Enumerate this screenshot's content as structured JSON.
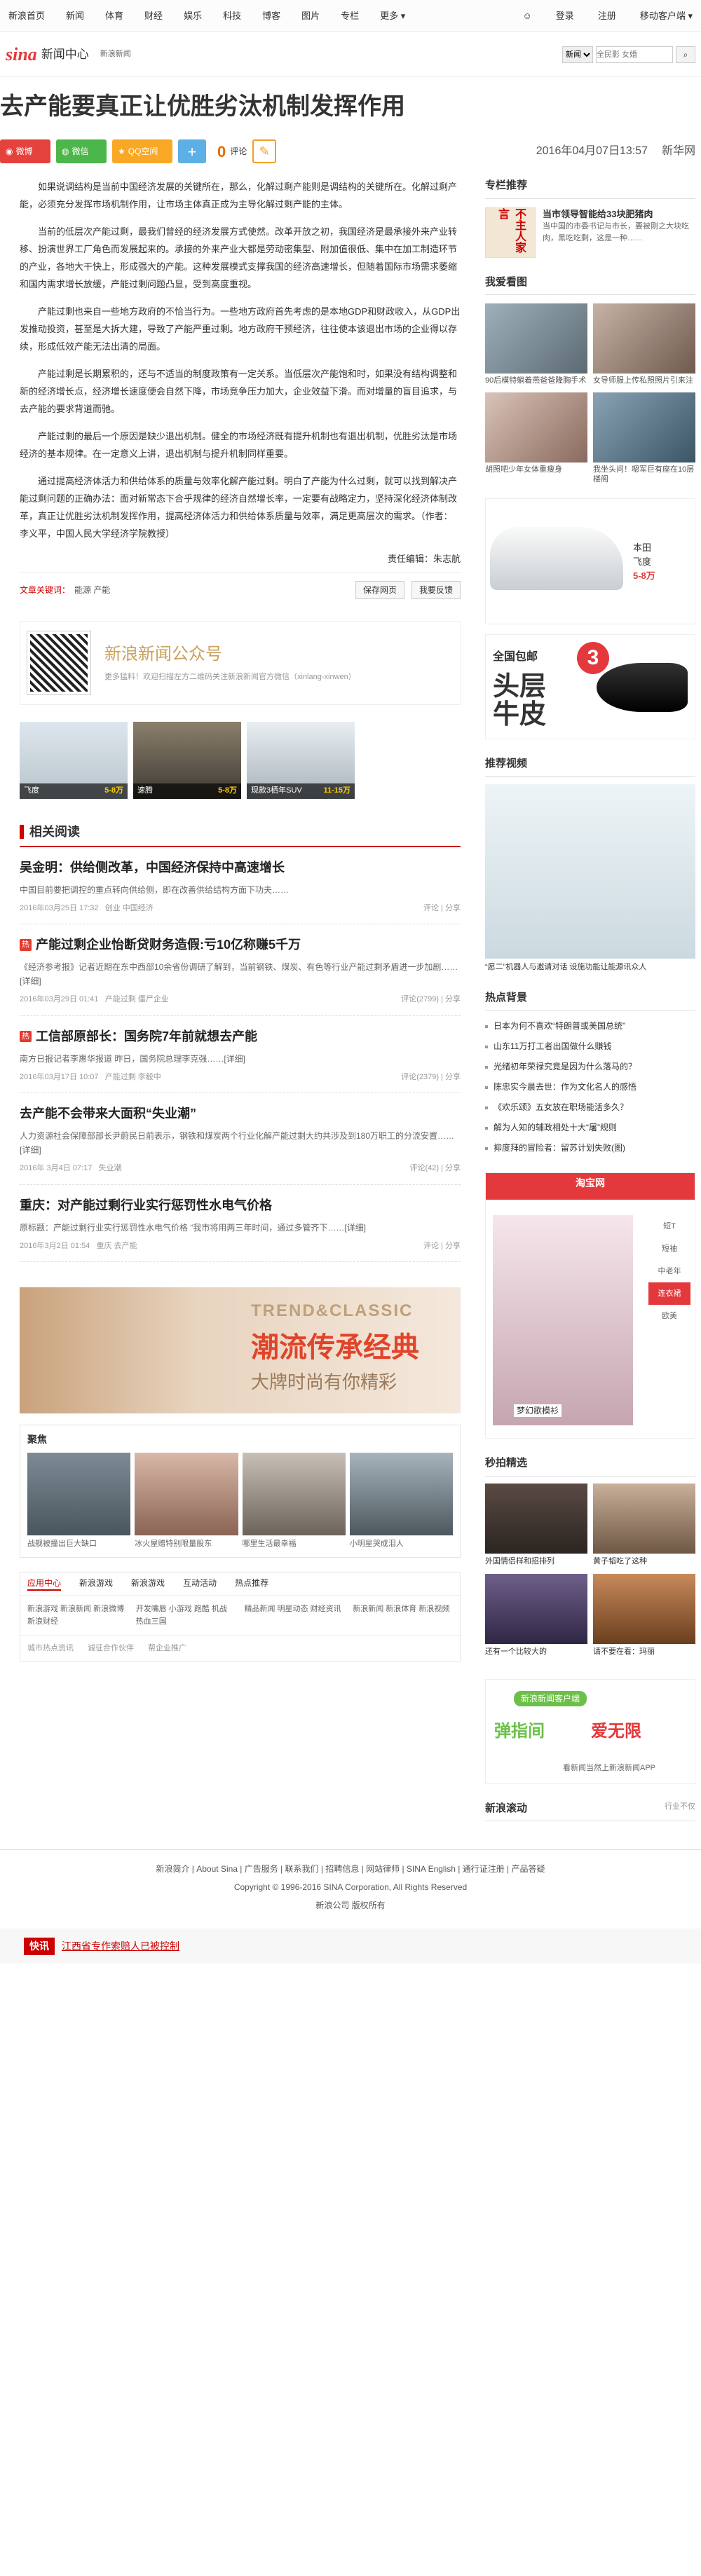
{
  "top_nav": {
    "items": [
      "新浪首页",
      "新闻",
      "体育",
      "财经",
      "娱乐",
      "科技",
      "博客",
      "图片",
      "专栏",
      "更多"
    ],
    "login": "登录",
    "register": "注册",
    "mobile": "移动客户端"
  },
  "header": {
    "logo_sina": "sina",
    "logo_text": "新闻中心",
    "logo_sub": "新浪新闻",
    "search_scope": "新闻",
    "search_placeholder": "全民影 女婚"
  },
  "article": {
    "title": "去产能要真正让优胜劣汰机制发挥作用",
    "share_weibo": "微博",
    "share_weixin": "微信",
    "share_qq": "QQ空间",
    "share_plus": "+",
    "comment_count": "0",
    "comment_label": "评论",
    "date": "2016年04月07日13:57",
    "source": "新华网",
    "paragraphs": [
      "如果说调结构是当前中国经济发展的关键所在，那么，化解过剩产能则是调结构的关键所在。化解过剩产能，必须充分发挥市场机制作用，让市场主体真正成为主导化解过剩产能的主体。",
      "当前的低层次产能过剩，最我们曾经的经济发展方式使然。改革开放之初，我国经济是最承接外来产业转移、扮演世界工厂角色而发展起来的。承接的外来产业大都是劳动密集型、附加值很低、集中在加工制造环节的产业，各地大干快上，形成强大的产能。这种发展模式支撑我国的经济高速增长，但随着国际市场需求萎缩和国内需求增长放缓，产能过剩问题凸显，受到高度重视。",
      "产能过剩也来自一些地方政府的不恰当行为。一些地方政府首先考虑的是本地GDP和财政收入，从GDP出发推动投资，甚至是大拆大建，导致了产能严重过剩。地方政府干预经济，往往使本该退出市场的企业得以存续，形成低效产能无法出清的局面。",
      "产能过剩是长期累积的，还与不适当的制度政策有一定关系。当低层次产能饱和时，如果没有结构调整和新的经济增长点，经济增长速度便会自然下降，市场竞争压力加大，企业效益下滑。而对增量的盲目追求，与去产能的要求背道而驰。",
      "产能过剩的最后一个原因是缺少退出机制。健全的市场经济既有提升机制也有退出机制，优胜劣汰是市场经济的基本规律。在一定意义上讲，退出机制与提升机制同样重要。",
      "通过提高经济体活力和供给体系的质量与效率化解产能过剩。明白了产能为什么过剩，就可以找到解决产能过剩问题的正确办法：面对新常态下合乎规律的经济自然增长率，一定要有战略定力，坚持深化经济体制改革，真正让优胜劣汰机制发挥作用，提高经济体活力和供给体系质量与效率，满足更高层次的需求。（作者：李义平，中国人民大学经济学院教授）"
    ],
    "editor": "责任编辑：朱志航",
    "keywords_label": "文章关键词：",
    "keywords": "能源 产能",
    "btn_save": "保存网页",
    "btn_feedback": "我要反馈"
  },
  "wechat_promo": {
    "title": "新浪新闻公众号",
    "sub": "更多猛料！欢迎扫描左方二维码关注新浪新闻官方微信（xinlang-xinwen）"
  },
  "car_ads": [
    {
      "name": "飞度",
      "price": "5-8万"
    },
    {
      "name": "速腾",
      "price": "5-8万"
    },
    {
      "name": "现款3栖年SUV",
      "price": "11-15万"
    }
  ],
  "related": {
    "title": "相关阅读",
    "items": [
      {
        "hot": "",
        "title": "吴金明：供给侧改革，中国经济保持中高速增长",
        "summary": "中国目前要把调控的重点转向供给侧，即在改善供给结构方面下功夫……",
        "date": "2016年03月25日 17:32",
        "tags": "创业 中国经济",
        "right": "评论 | 分享"
      },
      {
        "hot": "热",
        "title": "产能过剩企业怡断贷财务造假:亏10亿称赚5千万",
        "summary": "《经济参考报》记者近期在东中西部10余省份调研了解到，当前钢铁、煤炭、有色等行业产能过剩矛盾进一步加剧……[详细]",
        "date": "2016年03月29日 01:41",
        "tags": "产能过剩 僵尸企业",
        "right": "评论(2799) | 分享"
      },
      {
        "hot": "热",
        "title": "工信部原部长：国务院7年前就想去产能",
        "summary": "南方日报记者李惠华报道 昨日，国务院总理李克强……[详细]",
        "date": "2016年03月17日 10:07",
        "tags": "产能过剩 李毅中",
        "right": "评论(2379) | 分享"
      },
      {
        "hot": "",
        "title": "去产能不会带来大面积“失业潮”",
        "summary": "人力资源社会保障部部长尹蔚民日前表示，钢铁和煤炭两个行业化解产能过剩大约共涉及到180万职工的分流安置……[详细]",
        "date": "2016年 3月4日 07:17",
        "tags": "失业潮",
        "right": "评论(42) | 分享"
      },
      {
        "hot": "",
        "title": "重庆：对产能过剩行业实行惩罚性水电气价格",
        "summary": "原标题：产能过剩行业实行惩罚性水电气价格 “我市将用两三年时间，通过多管齐下……[详细]",
        "date": "2016年3月2日 01:54",
        "tags": "重庆 去产能",
        "right": "评论 | 分享"
      }
    ]
  },
  "ad_banner": {
    "t1": "TREND&CLASSIC",
    "t2": "潮流传承经典",
    "t3": "大牌时尚有你精彩"
  },
  "jujiao": {
    "title": "聚焦",
    "items": [
      {
        "cap": "战舰被撞出巨大缺口"
      },
      {
        "cap": "冰火屋赠特别限量股东"
      },
      {
        "cap": "哪里生活最幸福"
      },
      {
        "cap": "小明星哭成泪人"
      }
    ]
  },
  "tabs": {
    "labels": [
      "应用中心",
      "新浪游戏",
      "新浪游戏",
      "互动活动",
      "热点推荐"
    ],
    "cols": [
      "新浪游戏 新浪新闻 新浪微博 新浪财经",
      "开发嘴唇 小游戏 跑酷 机战 热血三国",
      "精品新闻 明星动态 财经资讯",
      "新浪新闻 新浪体育 新浪视频",
      "社会热点 国际快讯 独家报道"
    ],
    "foot": [
      "城市热点资讯",
      "诚征合作伙伴",
      "帮企业推广"
    ]
  },
  "footer": {
    "links": "新浪简介 | About Sina | 广告服务 | 联系我们 | 招聘信息 | 网站律师 | SINA English | 通行证注册 | 产品答疑",
    "copyright": "Copyright © 1996-2016 SINA Corporation, All Rights Reserved",
    "company": "新浪公司 版权所有"
  },
  "flash": {
    "label": "快讯",
    "text": "江西省专作索赔人已被控制"
  },
  "sidebar": {
    "zhuanlan_title": "专栏推荐",
    "zhuanlan_head": "当市领导智能给33块肥猪肉",
    "zhuanlan_text": "当中国的市委书记与市长，要被刚之大块吃肉，黑吃吃剩，这是一种……",
    "zhuanlan_img": "不主人家言",
    "tuijian_title": "我爱看图",
    "pics": [
      {
        "cap": "90后模特躺着燕爸爸隆胸手术"
      },
      {
        "cap": "女导师服上传私照照片引来注"
      },
      {
        "cap": "胡照吧少年女体重瘦身"
      },
      {
        "cap": "我坐头问！嗯军巨有座在10层楼阁"
      }
    ],
    "car": {
      "name": "本田",
      "model": "飞度",
      "price": "5-8万"
    },
    "shoe": {
      "a": "全国包邮",
      "b": "头层\n牛皮",
      "c": "3"
    },
    "video_title": "推荐视频",
    "video_cap": "“愿二”机器人与邀请对话 设施功能让能源讯众人",
    "hot_title": "热点背景",
    "hot_items": [
      "日本为何不喜欢“特朗普或美国总统”",
      "山东11万打工者出国做什么赚钱",
      "光绪初年荣禄究竟是因为什么落马的？",
      "陈忠实今晨去世：作为文化名人的感悟",
      "《欢乐颂》五女放在职场能活多久？",
      "解为人知的辅政相处十大“屠”规则",
      "抑度拜的冒险者：留苏计划失败(图)"
    ],
    "taobao_title": "淘宝网",
    "taobao_tags": [
      "短T",
      "短袖",
      "中老年",
      "连衣裙",
      "欧美"
    ],
    "taobao_active": "连衣裙",
    "taobao_tagline": "梦幻歌模衫",
    "mp_title": "秒拍精选",
    "mps": [
      {
        "cap": "外国情侣样和招排列"
      },
      {
        "cap": "黄子韬吃了这种"
      },
      {
        "cap": "还有一个比较大的"
      },
      {
        "cap": "请不要在看：玛丽"
      }
    ],
    "app": {
      "top": "新浪新闻客户端",
      "t": "弹指间",
      "t2": "爱无限",
      "small": "看新闻当然上新浪新闻APP"
    },
    "gundong_title": "新浪滚动",
    "gundong_more": "行业不仅"
  }
}
